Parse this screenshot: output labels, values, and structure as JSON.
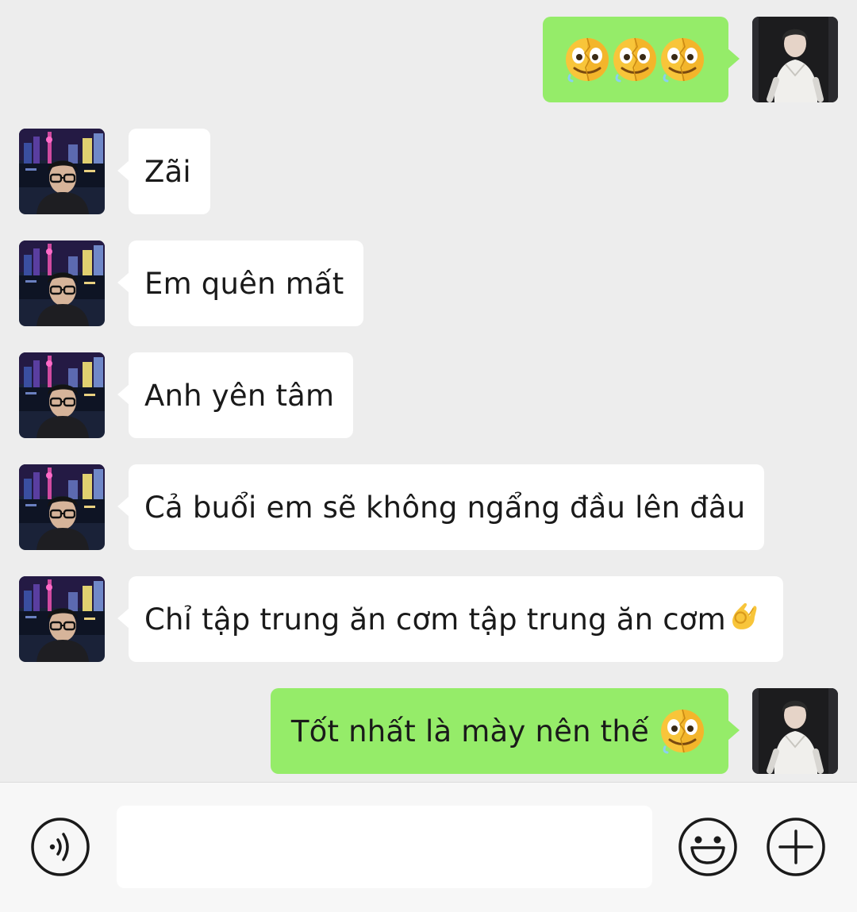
{
  "messages": [
    {
      "sender": "me",
      "text": "",
      "emoji_count": 3,
      "emoji": "melting-face"
    },
    {
      "sender": "friend",
      "text": "Zãi"
    },
    {
      "sender": "friend",
      "text": "Em quên mất"
    },
    {
      "sender": "friend",
      "text": "Anh yên tâm"
    },
    {
      "sender": "friend",
      "text": "Cả buổi em sẽ không ngẩng đầu lên đâu"
    },
    {
      "sender": "friend",
      "text": "Chỉ tập trung ăn cơm tập trung ăn cơm",
      "trailing_emoji": "ok-hand"
    },
    {
      "sender": "me",
      "text": "Tốt nhất là mày nên thế",
      "trailing_emoji": "melting-face"
    }
  ],
  "input": {
    "value": "",
    "placeholder": ""
  },
  "icons": {
    "voice": "voice-icon",
    "emoji": "emoji-smiley-icon",
    "more": "plus-icon"
  },
  "colors": {
    "background": "#ededed",
    "incoming_bubble": "#ffffff",
    "outgoing_bubble": "#95ec69",
    "input_bar": "#f7f7f7"
  }
}
